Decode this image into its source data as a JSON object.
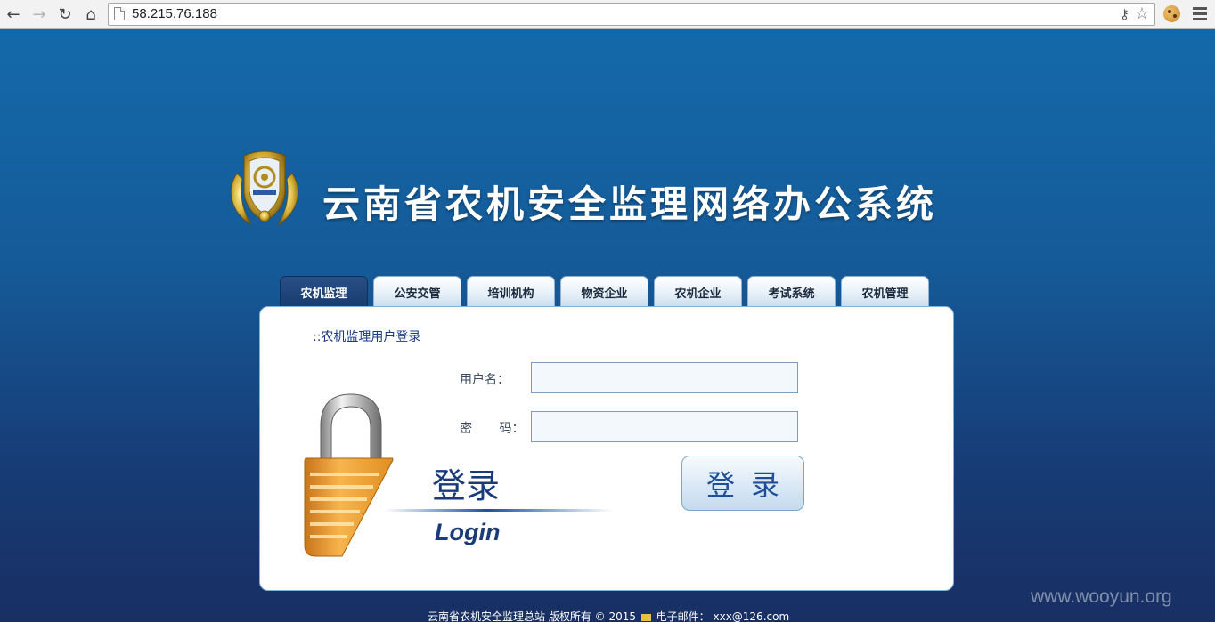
{
  "browser": {
    "url": "58.215.76.188",
    "icons": [
      "back-icon",
      "forward-icon",
      "reload-icon",
      "home-icon",
      "page-icon",
      "key-icon",
      "star-icon",
      "cookie-icon",
      "menu-icon"
    ]
  },
  "header": {
    "title": "云南省农机安全监理网络办公系统"
  },
  "tabs": [
    {
      "label": "农机监理",
      "active": true
    },
    {
      "label": "公安交管",
      "active": false
    },
    {
      "label": "培训机构",
      "active": false
    },
    {
      "label": "物资企业",
      "active": false
    },
    {
      "label": "农机企业",
      "active": false
    },
    {
      "label": "考试系统",
      "active": false
    },
    {
      "label": "农机管理",
      "active": false
    }
  ],
  "login": {
    "panel_title": "::农机监理用户登录",
    "username_label": "用户名：",
    "password_label": "密 码：",
    "username_value": "",
    "password_value": "",
    "submit_label": "登录",
    "graphic_cn": "登录",
    "graphic_en": "Login"
  },
  "footer": {
    "copyright": "云南省农机安全监理总站 版权所有 © 2015",
    "email_label": "电子邮件：",
    "email": "xxx@126.com"
  },
  "watermark": "www.wooyun.org",
  "colors": {
    "background_top": "#0f6aad",
    "background_bottom": "#182f63",
    "active_tab": "#173c6e",
    "accent": "#1f4f9a"
  }
}
